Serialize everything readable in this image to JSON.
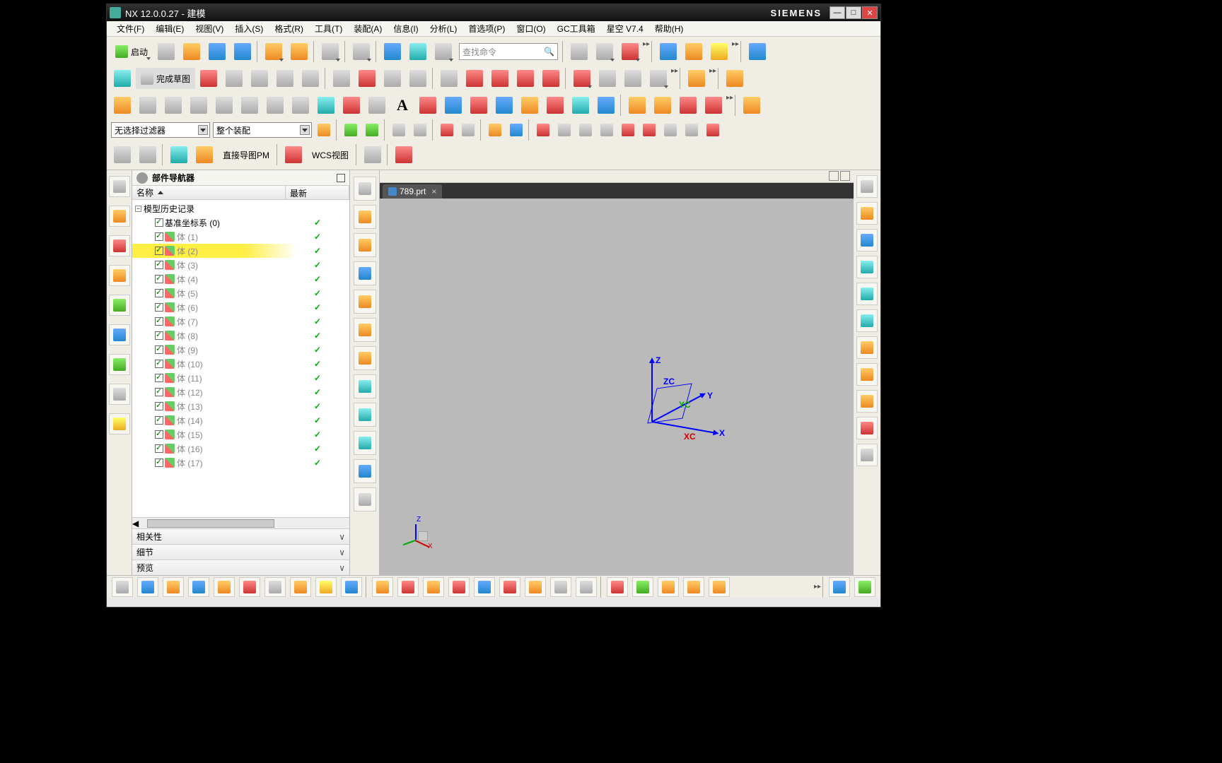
{
  "title": "NX 12.0.0.27 - 建模",
  "brand": "SIEMENS",
  "menu": [
    "文件(F)",
    "编辑(E)",
    "视图(V)",
    "插入(S)",
    "格式(R)",
    "工具(T)",
    "装配(A)",
    "信息(I)",
    "分析(L)",
    "首选项(P)",
    "窗口(O)",
    "GC工具箱",
    "星空 V7.4",
    "帮助(H)"
  ],
  "launch_label": "启动",
  "finish_sketch_label": "完成草图",
  "search_placeholder": "查找命令",
  "filter_combo": "无选择过滤器",
  "assembly_combo": "整个装配",
  "direct_sketch_label": "直接导图PM",
  "wcs_view_label": "WCS视图",
  "nav_title": "部件导航器",
  "col_name": "名称",
  "col_latest": "最新",
  "tree_root": "模型历史记录",
  "tree_items": [
    {
      "label": "基准坐标系 (0)",
      "dark": true,
      "icon": "csys"
    },
    {
      "label": "体 (1)",
      "icon": "body"
    },
    {
      "label": "体 (2)",
      "icon": "body",
      "highlight": true
    },
    {
      "label": "体 (3)",
      "icon": "body"
    },
    {
      "label": "体 (4)",
      "icon": "body"
    },
    {
      "label": "体 (5)",
      "icon": "body"
    },
    {
      "label": "体 (6)",
      "icon": "body"
    },
    {
      "label": "体 (7)",
      "icon": "body"
    },
    {
      "label": "体 (8)",
      "icon": "body"
    },
    {
      "label": "体 (9)",
      "icon": "body"
    },
    {
      "label": "体 (10)",
      "icon": "body"
    },
    {
      "label": "体 (11)",
      "icon": "body"
    },
    {
      "label": "体 (12)",
      "icon": "body"
    },
    {
      "label": "体 (13)",
      "icon": "body"
    },
    {
      "label": "体 (14)",
      "icon": "body"
    },
    {
      "label": "体 (15)",
      "icon": "body"
    },
    {
      "label": "体 (16)",
      "icon": "body"
    },
    {
      "label": "体 (17)",
      "icon": "body"
    }
  ],
  "collapsed_sections": [
    "相关性",
    "细节",
    "预览"
  ],
  "tab_name": "789.prt",
  "axes": {
    "x": "X",
    "y": "Y",
    "z": "Z",
    "xc": "XC",
    "yc": "YC",
    "zc": "ZC"
  }
}
